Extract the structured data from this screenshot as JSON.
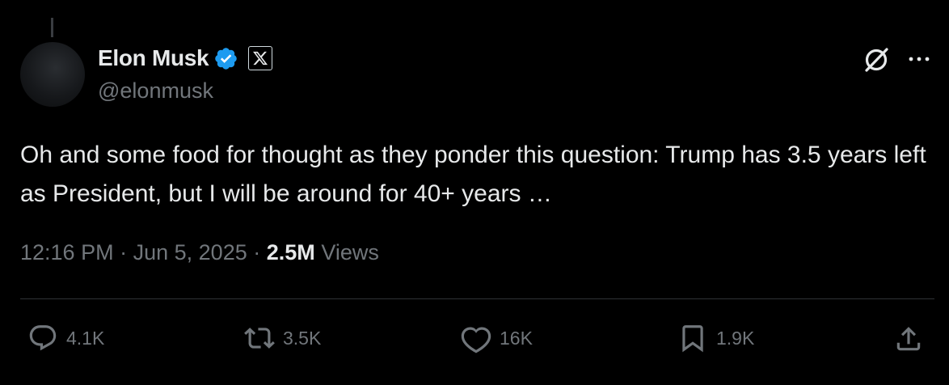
{
  "author": {
    "display_name": "Elon Musk",
    "handle": "@elonmusk",
    "verified": true,
    "affiliation_badge": "X",
    "verified_color": "#1d9bf0"
  },
  "header_icons": [
    "grok-icon",
    "more-icon"
  ],
  "tweet": {
    "text": "Oh and some food for thought as they ponder this question: Trump has 3.5 years left as President, but I will be around for 40+ years …",
    "time": "12:16 PM",
    "separator": "·",
    "date": "Jun 5, 2025",
    "views_count": "2.5M",
    "views_label": "Views"
  },
  "actions": {
    "replies": "4.1K",
    "reposts": "3.5K",
    "likes": "16K",
    "bookmarks": "1.9K"
  },
  "colors": {
    "background": "#000000",
    "text_primary": "#e7e9ea",
    "text_secondary": "#71767b",
    "divider": "#2f3336"
  }
}
